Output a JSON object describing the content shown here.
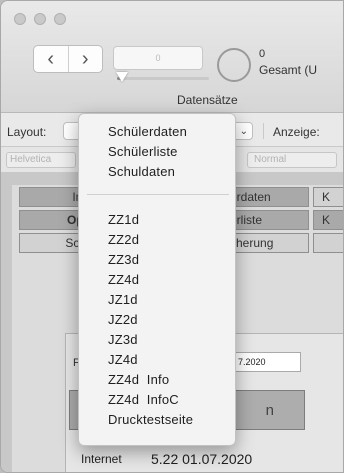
{
  "toolbar": {
    "record_field_value": "0",
    "slider_value": 0.05,
    "count_value": "0",
    "count_label": "Gesamt (U",
    "caption": "Datensätze",
    "nav_back_icon": "chevron-left-icon",
    "nav_forward_icon": "chevron-right-icon"
  },
  "layoutbar": {
    "layout_label": "Layout:",
    "anzeige_label": "Anzeige:",
    "popup_end_glyph": "⌄"
  },
  "formatbar": {
    "font_value": "Helvetica",
    "style_value": "Normal"
  },
  "content": {
    "buttons": [
      {
        "label": "Im",
        "dark": true
      },
      {
        "label": "Opti",
        "dark": true,
        "bold": true
      },
      {
        "label": "Schu",
        "dark": false
      },
      {
        "label": "erdaten",
        "dark": true
      },
      {
        "label": "erliste",
        "dark": true
      },
      {
        "label": "cherung",
        "dark": false
      },
      {
        "label": "K",
        "dark": false
      },
      {
        "label": "K",
        "dark": false
      }
    ],
    "date_row_label": "F",
    "date_value": "7.2020",
    "big_button_label": "n",
    "internet_label": "Internet",
    "internet_value": "5.22 01.07.2020"
  },
  "menu": {
    "group1": [
      "Schülerdaten",
      "Schülerliste",
      "Schuldaten"
    ],
    "group2": [
      "ZZ1d",
      "ZZ2d",
      "ZZ3d",
      "ZZ4d",
      "JZ1d",
      "JZ2d",
      "JZ3d",
      "JZ4d",
      "ZZ4d  Info",
      "ZZ4d  InfoC",
      "Drucktestseite"
    ]
  }
}
